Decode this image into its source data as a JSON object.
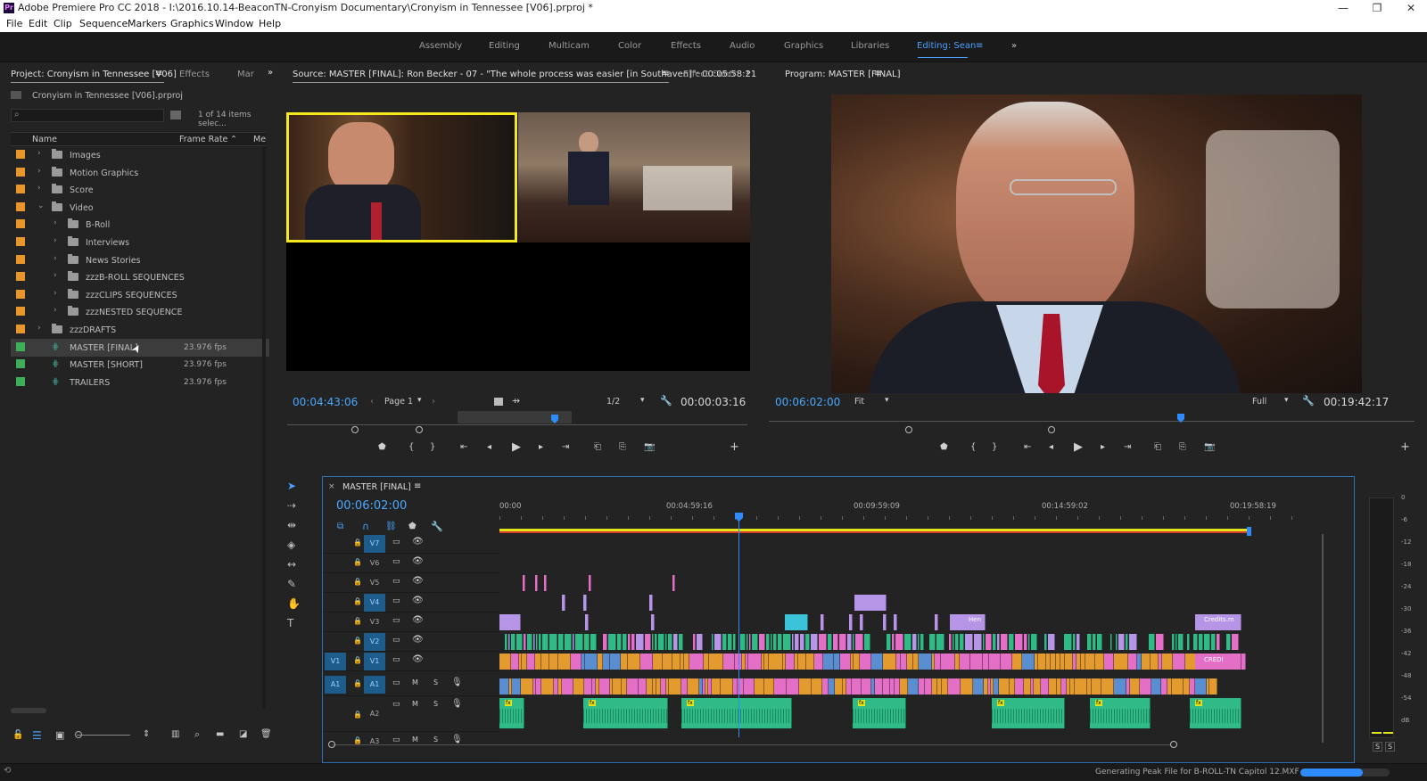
{
  "window": {
    "title": "Adobe Premiere Pro CC 2018 - I:\\2016.10.14-BeaconTN-Cronyism Documentary\\Cronyism in Tennessee [V06].prproj *",
    "app_icon": "Pr",
    "minimize": "—",
    "restore": "❐",
    "close": "✕"
  },
  "menu": [
    "File",
    "Edit",
    "Clip",
    "Sequence",
    "Markers",
    "Graphics",
    "Window",
    "Help"
  ],
  "workspaces": {
    "items": [
      "Assembly",
      "Editing",
      "Multicam",
      "Color",
      "Effects",
      "Audio",
      "Graphics",
      "Libraries",
      "Editing: Sean"
    ],
    "active": "Editing: Sean",
    "more": "»",
    "menu_icon": "≡"
  },
  "project_panel": {
    "tabs": [
      "Project: Cronyism in Tennessee [V06]",
      "Effects",
      "Mar"
    ],
    "menu_icon": "≡",
    "overflow": "»",
    "file": "Cronyism in Tennessee [V06].prproj",
    "search_placeholder": "",
    "count": "1 of 14 items selec...",
    "columns": {
      "name": "Name",
      "frame_rate": "Frame Rate",
      "media": "Me",
      "sort_icon": "⌃"
    },
    "items": [
      {
        "label": "Images",
        "type": "folder",
        "level": 0,
        "color": "#e8952b",
        "expand": "›"
      },
      {
        "label": "Motion Graphics",
        "type": "folder",
        "level": 0,
        "color": "#e8952b",
        "expand": "›"
      },
      {
        "label": "Score",
        "type": "folder",
        "level": 0,
        "color": "#e8952b",
        "expand": "›"
      },
      {
        "label": "Video",
        "type": "folder",
        "level": 0,
        "color": "#e8952b",
        "expand": "⌄"
      },
      {
        "label": "B-Roll",
        "type": "folder",
        "level": 1,
        "color": "#e8952b",
        "expand": "›"
      },
      {
        "label": "Interviews",
        "type": "folder",
        "level": 1,
        "color": "#e8952b",
        "expand": "›"
      },
      {
        "label": "News Stories",
        "type": "folder",
        "level": 1,
        "color": "#e8952b",
        "expand": "›"
      },
      {
        "label": "zzzB-ROLL SEQUENCES",
        "type": "folder",
        "level": 1,
        "color": "#e8952b",
        "expand": "›"
      },
      {
        "label": "zzzCLIPS SEQUENCES",
        "type": "folder",
        "level": 1,
        "color": "#e8952b",
        "expand": "›"
      },
      {
        "label": "zzzNESTED SEQUENCE",
        "type": "folder",
        "level": 1,
        "color": "#e8952b",
        "expand": "›"
      },
      {
        "label": "zzzDRAFTS",
        "type": "folder",
        "level": 0,
        "color": "#e8952b",
        "expand": "›"
      },
      {
        "label": "MASTER [FINAL]",
        "type": "sequence",
        "level": 0,
        "color": "#3fae5a",
        "fps": "23.976 fps",
        "selected": true
      },
      {
        "label": "MASTER [SHORT]",
        "type": "sequence",
        "level": 0,
        "color": "#3fae5a",
        "fps": "23.976 fps"
      },
      {
        "label": "TRAILERS",
        "type": "sequence",
        "level": 0,
        "color": "#3fae5a",
        "fps": "23.976 fps"
      }
    ]
  },
  "source_monitor": {
    "tab": "Source: MASTER [FINAL]: Ron Becker - 07 - \"The whole process was easier [in Southaven]\": 00:05:58:21",
    "menu_icon": "≡",
    "second_tab": "Effect Contr",
    "overflow": "»",
    "timecode": "00:04:43:06",
    "page": "Page 1",
    "resolution": "1/2",
    "duration": "00:00:03:16"
  },
  "program_monitor": {
    "tab": "Program: MASTER [FINAL]",
    "menu_icon": "≡",
    "timecode": "00:06:02:00",
    "fit": "Fit",
    "quality": "Full",
    "duration": "00:19:42:17"
  },
  "transport_icons": {
    "marker": "⬟",
    "in": "{",
    "out": "}",
    "goto_in": "⇤",
    "step_back": "◂",
    "play": "▶",
    "step_fwd": "▸",
    "goto_out": "⇥",
    "insert": "⎗",
    "overwrite": "⎘",
    "export": "📷",
    "add": "+",
    "wrench": "🔧",
    "settings": "≡",
    "dropdown": "▾"
  },
  "timeline": {
    "tab": "MASTER [FINAL]",
    "close_icon": "×",
    "menu_icon": "≡",
    "timecode": "00:06:02:00",
    "ruler": [
      "00:00",
      "00:04:59:16",
      "00:09:59:09",
      "00:14:59:02",
      "00:19:58:19"
    ],
    "video_tracks": [
      "V7",
      "V6",
      "V5",
      "V4",
      "V3",
      "V2",
      "V1"
    ],
    "audio_tracks": [
      "A1",
      "A2",
      "A3"
    ],
    "source_patch": {
      "v": "V1",
      "a": "A1"
    },
    "audio_buttons": {
      "mute": "M",
      "solo": "S"
    },
    "playhead_fraction": 0.305,
    "clip_labels": [
      "Hen",
      "Credits.m",
      "CREDI"
    ],
    "audio_clip_badge": "fx"
  },
  "tools": [
    "selection",
    "track-select",
    "ripple",
    "razor",
    "slip",
    "pen",
    "hand",
    "type"
  ],
  "tool_type_glyph": "T",
  "meter": {
    "scale": [
      "0",
      "-6",
      "-12",
      "-18",
      "-24",
      "-30",
      "-36",
      "-42",
      "-48",
      "-54",
      "dB"
    ],
    "solo": [
      "S",
      "S"
    ]
  },
  "status": {
    "message": "Generating Peak File for B-ROLL-TN Capitol 12.MXF",
    "progress": 0.7
  },
  "colors": {
    "accent": "#2f8cff",
    "pink": "#e36fc7",
    "orange": "#e39a2f",
    "green": "#2fba86",
    "lavender": "#b695e6",
    "cyan": "#3bc4d9",
    "yellow": "#e3e31b",
    "red": "#d23a2a"
  }
}
